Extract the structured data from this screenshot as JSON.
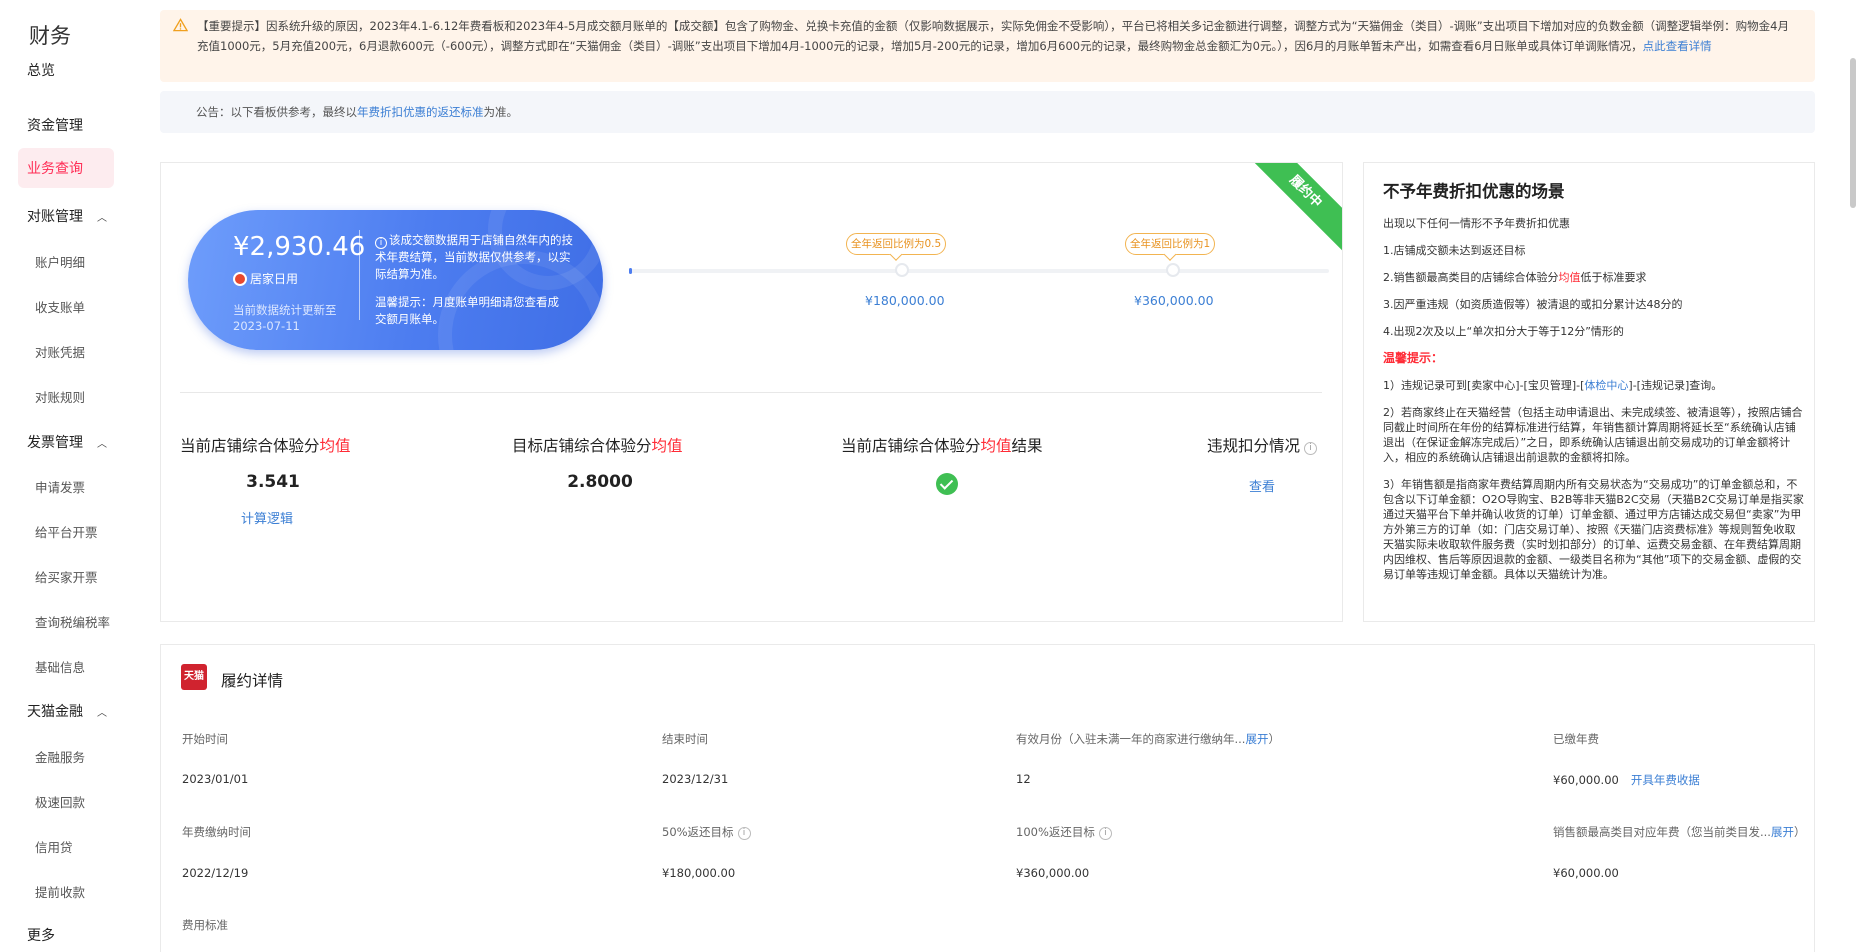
{
  "sidebar": {
    "title": "财务",
    "items": [
      {
        "label": "总览"
      },
      {
        "label": "资金管理"
      },
      {
        "label": "业务查询"
      },
      {
        "label": "对账管理"
      },
      {
        "label": "账户明细"
      },
      {
        "label": "收支账单"
      },
      {
        "label": "对账凭据"
      },
      {
        "label": "对账规则"
      },
      {
        "label": "发票管理"
      },
      {
        "label": "申请发票"
      },
      {
        "label": "给平台开票"
      },
      {
        "label": "给买家开票"
      },
      {
        "label": "查询税编税率"
      },
      {
        "label": "基础信息"
      },
      {
        "label": "天猫金融"
      },
      {
        "label": "金融服务"
      },
      {
        "label": "极速回款"
      },
      {
        "label": "信用贷"
      },
      {
        "label": "提前收款"
      },
      {
        "label": "更多"
      }
    ]
  },
  "notice": {
    "text": "【重要提示】因系统升级的原因，2023年4.1-6.12年费看板和2023年4-5月成交额月账单的【成交额】包含了购物金、兑换卡充值的金额（仅影响数据展示，实际免佣金不受影响），平台已将相关多记金额进行调整，调整方式为“天猫佣金（类目）-调账”支出项目下增加对应的负数金额（调整逻辑举例：购物金4月充值1000元，5月充值200元，6月退款600元（-600元），调整方式即在“天猫佣金（类目）-调账”支出项目下增加4月-1000元的记录，增加5月-200元的记录，增加6月600元的记录，最终购物金总金额汇为0元。），因6月的月账单暂未产出，如需查看6月日账单或具体订单调账情况，",
    "link": "点此查看详情"
  },
  "announce": {
    "prefix": "公告：以下看板供参考，最终以",
    "link": "年费折扣优惠的返还标准",
    "suffix": "为准。"
  },
  "perf": {
    "ribbon": "履约中",
    "amount": "¥2,930.46",
    "shop_name": "居家日用",
    "update_text": "当前数据统计更新至 2023-07-11",
    "info_text": "该成交额数据用于店铺自然年内的技术年费结算，当前数据仅供参考，以实际结算为准。",
    "tip_text": "温馨提示：月度账单明细请您查看成交额月账单。",
    "tag_half": "全年返回比例为0.5",
    "tag_full": "全年返回比例为1",
    "target_half": "¥180,000.00",
    "target_full": "¥360,000.00",
    "metrics": {
      "current_label": "当前店铺综合体验分",
      "target_label": "目标店铺综合体验分",
      "result_label_prefix": "当前店铺综合体验分",
      "result_label_suffix": "结果",
      "avg": "均值",
      "violation_label": "违规扣分情况",
      "current_value": "3.541",
      "target_value": "2.8000",
      "calc_link": "计算逻辑",
      "view_link": "查看"
    }
  },
  "rules": {
    "title": "不予年费折扣优惠的场景",
    "intro": "出现以下任何一情形不予年费折扣优惠",
    "r1": "1.店铺成交额未达到返还目标",
    "r2_pre": "2.销售额最高类目的店铺综合体验分",
    "r2_red": "均值",
    "r2_post": "低于标准要求",
    "r3": "3.因严重违规（如资质造假等）被清退的或扣分累计达48分的",
    "r4": "4.出现2次及以上“单次扣分大于等于12分”情形的",
    "warm": "温馨提示：",
    "t1_pre": "1）违规记录可到[卖家中心]-[宝贝管理]-[",
    "t1_link": "体检中心",
    "t1_post": "]-[违规记录]查询。",
    "t2": "2）若商家终止在天猫经营（包括主动申请退出、未完成续签、被清退等），按照店铺合同截止时间所在年份的结算标准进行结算，年销售额计算周期将延长至“系统确认店铺退出（在保证金解冻完成后）”之日，即系统确认店铺退出前交易成功的订单金额将计入，相应的系统确认店铺退出前退款的金额将扣除。",
    "t3": "3）年销售额是指商家年费结算周期内所有交易状态为“交易成功”的订单金额总和，不包含以下订单金额：O2O导购宝、B2B等非天猫B2C交易（天猫B2C交易订单是指买家通过天猫平台下单并确认收货的订单）订单金额、通过甲方店铺达成交易但“卖家”为甲方外第三方的订单（如：门店交易订单）、按照《天猫门店资费标准》等规则暂免收取天猫实际未收取软件服务费（实时划扣部分）的订单、运费交易金额、在年费结算周期内因维权、售后等原因退款的金额、一级类目名称为“其他”项下的交易金额、虚假的交易订单等违规订单金额。具体以天猫统计为准。"
  },
  "detail": {
    "title": "履约详情",
    "logo": "天猫",
    "labels": {
      "start": "开始时间",
      "end": "结束时间",
      "months": "有效月份（入驻未满一年的商家进行缴纳年...",
      "months_expand": "展开",
      "paid": "已缴年费",
      "pay_time": "年费缴纳时间",
      "half_target": "50%返还目标",
      "full_target": "100%返还目标",
      "top_cat": "销售额最高类目对应年费（您当前类目发...",
      "top_cat_expand": "展开",
      "fee_std": "费用标准"
    },
    "values": {
      "start": "2023/01/01",
      "end": "2023/12/31",
      "months": "12",
      "paid": "¥60,000.00",
      "receipt_link": "开具年费收据",
      "pay_time": "2022/12/19",
      "half_target": "¥180,000.00",
      "full_target": "¥360,000.00",
      "top_cat": "¥60,000.00"
    }
  },
  "colors": {
    "accent_red": "#ff2c37",
    "link_blue": "#3c7fd4",
    "success_green": "#3fbf53",
    "card_blue": "#4d7df0",
    "tag_orange": "#f2b451"
  }
}
